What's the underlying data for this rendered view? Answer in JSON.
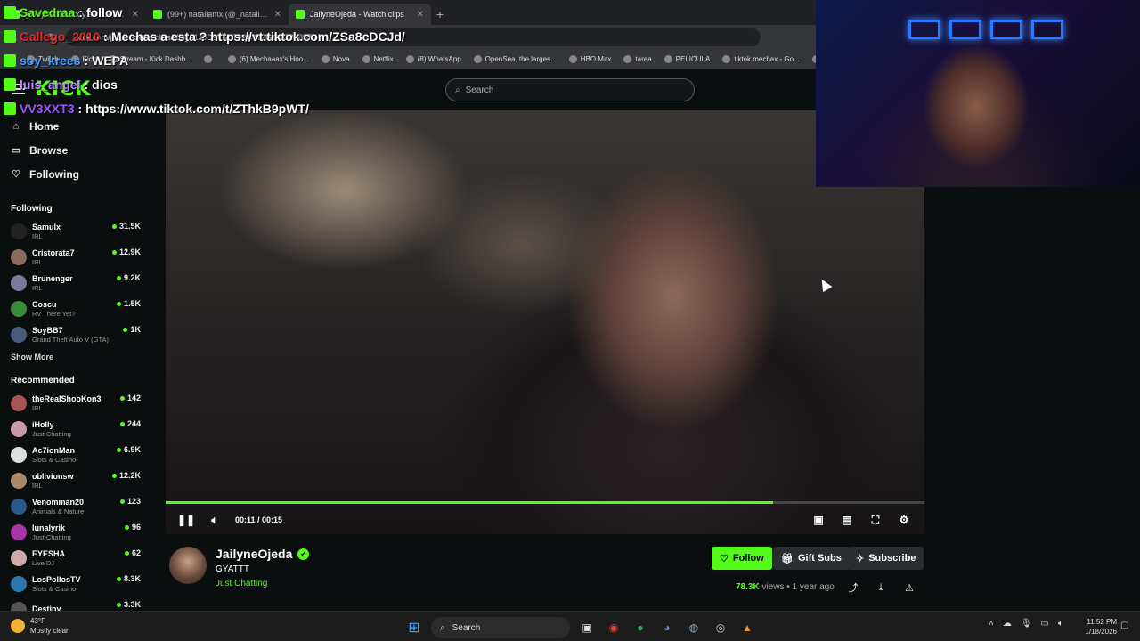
{
  "browser": {
    "tabs": [
      {
        "title": "(99+)Nataliamx y su nuevo est",
        "active": false
      },
      {
        "title": "(99+) nataliamx (@_nataliamx) |",
        "active": false
      },
      {
        "title": "JailyneOjeda - Watch clips",
        "active": true
      }
    ],
    "url": "kick.com/jailyneojeda/clips/clip_01J9D9KN07924RT2WG5S2T8575",
    "bookmarks": [
      "Twitch",
      "Kick",
      "Stream - Kick Dashb...",
      "",
      "(6) Mechaaax's Hoo...",
      "Nova",
      "Netflix",
      "(8) WhatsApp",
      "OpenSea, the larges...",
      "HBO Max",
      "tarea",
      "PELICULA",
      "tiktok mechax - Go...",
      "Turi"
    ]
  },
  "chat_overlay": [
    {
      "user": "Savedraa",
      "message": "follow",
      "user_color": "#53fc18"
    },
    {
      "user": "Gallego_2010",
      "message": "Mechas a esta ? https://vt.tiktok.com/ZSa8cDCJd/",
      "user_color": "#e02a2a"
    },
    {
      "user": "soy_krees",
      "message": "WEPA",
      "user_color": "#4aa3ff"
    },
    {
      "user": "luis_angel",
      "message": "dios",
      "user_color": "#b98aff"
    },
    {
      "user": "VV3XXT3",
      "message": "https://www.tiktok.com/t/ZThkB9pWT/",
      "user_color": "#9b59ff"
    }
  ],
  "kick": {
    "logo": "KICK",
    "search_placeholder": "Search"
  },
  "sidebar": {
    "nav": [
      {
        "label": "Home",
        "icon": "home-icon",
        "glyph": "⌂"
      },
      {
        "label": "Browse",
        "icon": "browse-icon",
        "glyph": "▭"
      },
      {
        "label": "Following",
        "icon": "heart-icon",
        "glyph": "♡"
      }
    ],
    "following_title": "Following",
    "following": [
      {
        "name": "Samulx",
        "category": "IRL",
        "viewers": "31.5K",
        "color": "#222"
      },
      {
        "name": "Cristorata7",
        "category": "IRL",
        "viewers": "12.9K",
        "color": "#8a6a5a"
      },
      {
        "name": "Brunenger",
        "category": "IRL",
        "viewers": "9.2K",
        "color": "#7a7a9a"
      },
      {
        "name": "Coscu",
        "category": "RV There Yet?",
        "viewers": "1.5K",
        "color": "#3a8a3a"
      },
      {
        "name": "SoyBB7",
        "category": "Grand Theft Auto V (GTA)",
        "viewers": "1K",
        "color": "#4a5a7a"
      }
    ],
    "show_more": "Show More",
    "recommended_title": "Recommended",
    "recommended": [
      {
        "name": "theRealShooKon3",
        "category": "IRL",
        "viewers": "142",
        "color": "#a55"
      },
      {
        "name": "iHolly",
        "category": "Just Chatting",
        "viewers": "244",
        "color": "#c9a"
      },
      {
        "name": "Ac7ionMan",
        "category": "Slots & Casino",
        "viewers": "6.9K",
        "color": "#ddd"
      },
      {
        "name": "oblivionsw",
        "category": "IRL",
        "viewers": "12.2K",
        "color": "#a86"
      },
      {
        "name": "Venomman20",
        "category": "Animals & Nature",
        "viewers": "123",
        "color": "#2a5a8a"
      },
      {
        "name": "lunalyrik",
        "category": "Just Chatting",
        "viewers": "96",
        "color": "#a3a"
      },
      {
        "name": "EYESHA",
        "category": "Live DJ",
        "viewers": "62",
        "color": "#caa"
      },
      {
        "name": "LosPollosTV",
        "category": "Slots & Casino",
        "viewers": "8.3K",
        "color": "#2a7ab0"
      },
      {
        "name": "Destiny",
        "category": "",
        "viewers": "3.3K",
        "color": "#555"
      }
    ]
  },
  "player": {
    "current_time": "00:11",
    "duration": "00:15",
    "progress_percent": 80
  },
  "clip": {
    "channel": "JailyneOjeda",
    "title": "GYATTT",
    "category": "Just Chatting",
    "follow_label": "Follow",
    "gift_label": "Gift Subs",
    "subscribe_label": "Subscribe",
    "views": "78.3K",
    "views_suffix": "views",
    "age": "1 year ago"
  },
  "taskbar": {
    "temperature": "43°F",
    "weather": "Mostly clear",
    "search_label": "Search",
    "time": "11:52 PM",
    "date": "1/18/2026"
  }
}
